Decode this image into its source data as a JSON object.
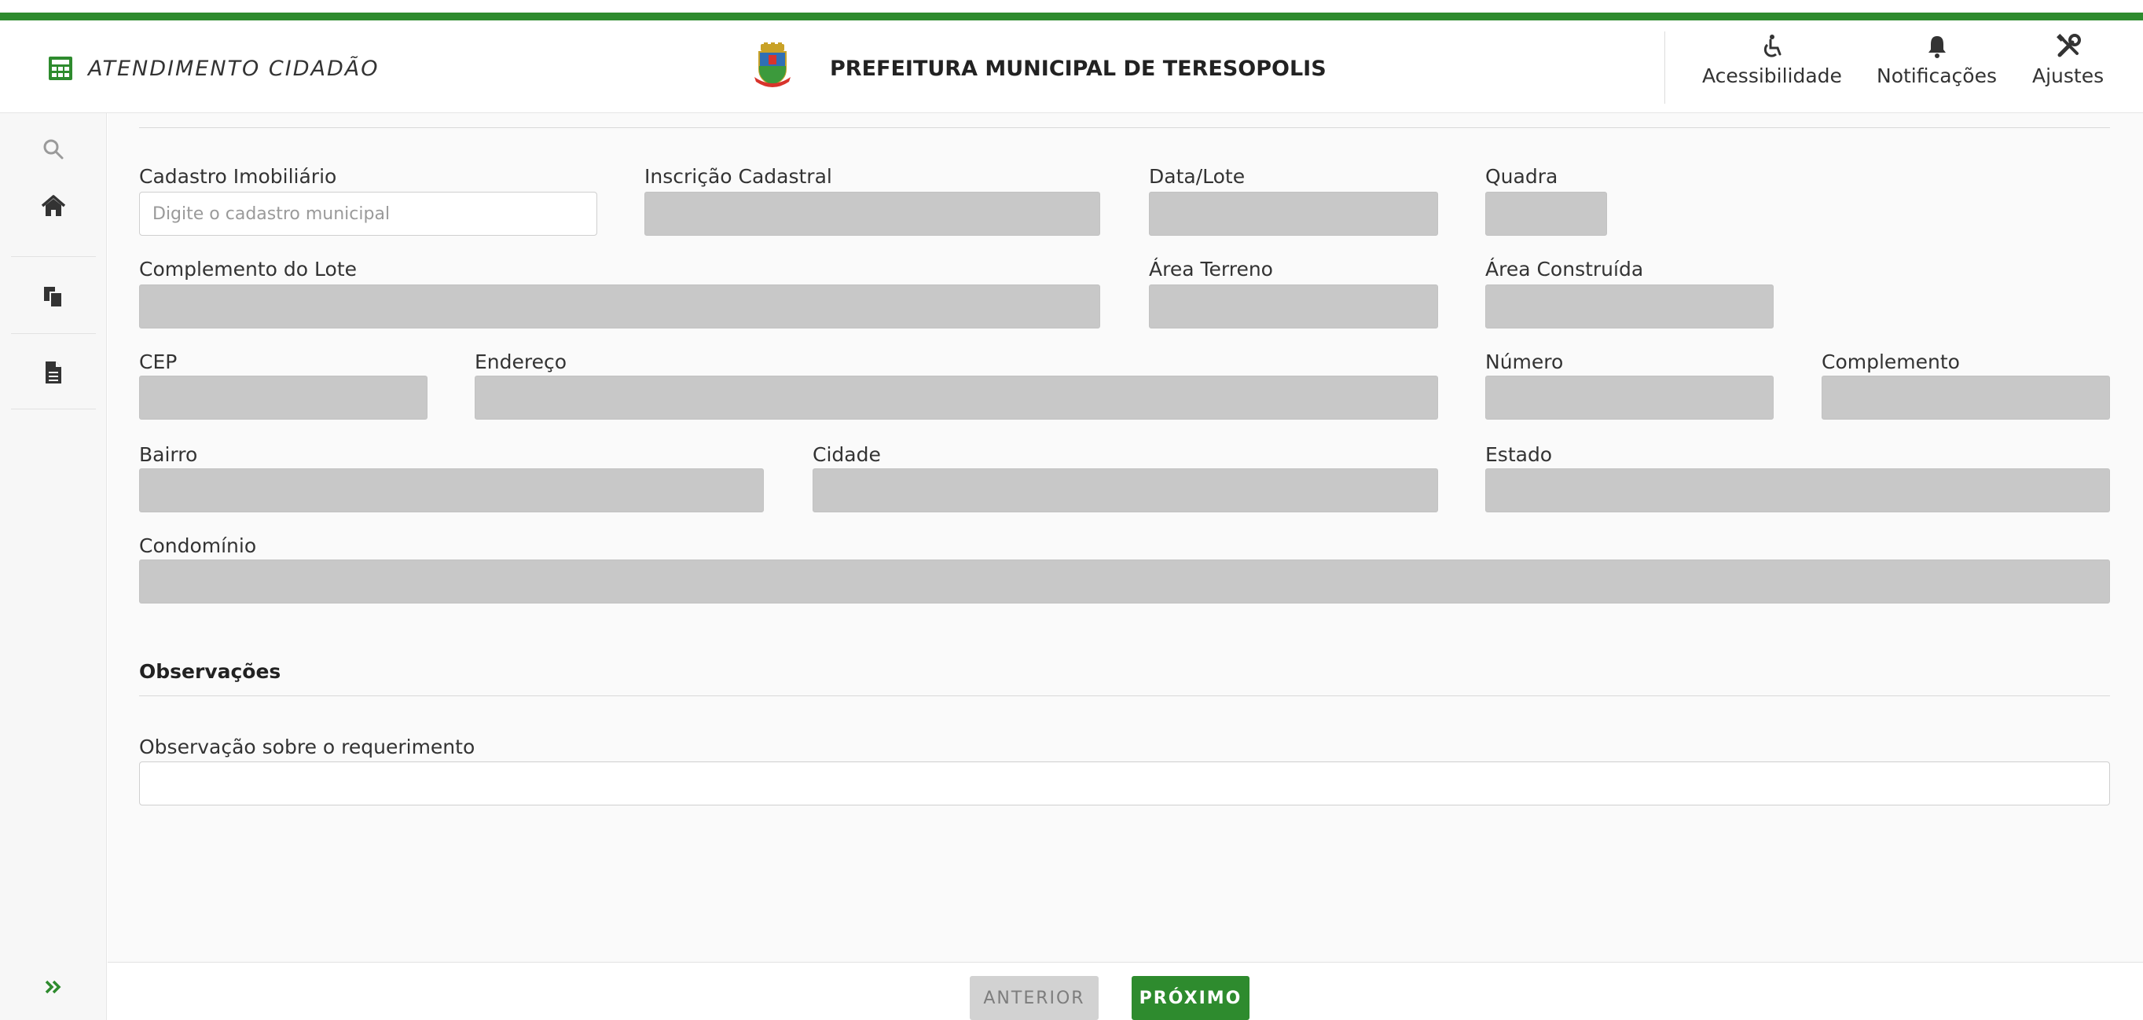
{
  "header": {
    "app_title": "ATENDIMENTO CIDADÃO",
    "municipality": "PREFEITURA MUNICIPAL DE TERESOPOLIS",
    "actions": [
      {
        "label": "Acessibilidade",
        "icon": "wheelchair-icon"
      },
      {
        "label": "Notificações",
        "icon": "bell-icon"
      },
      {
        "label": "Ajustes",
        "icon": "tools-icon"
      }
    ]
  },
  "sidebar": {
    "items": [
      {
        "icon": "search-icon"
      },
      {
        "icon": "home-icon"
      },
      {
        "icon": "copy-icon"
      },
      {
        "icon": "document-icon"
      }
    ],
    "expand_icon": "double-chevron-right-icon"
  },
  "form": {
    "cadastro_label": "Cadastro Imobiliário",
    "cadastro_placeholder": "Digite o cadastro municipal",
    "inscricao_label": "Inscrição Cadastral",
    "data_lote_label": "Data/Lote",
    "quadra_label": "Quadra",
    "complemento_lote_label": "Complemento do Lote",
    "area_terreno_label": "Área Terreno",
    "area_construida_label": "Área Construída",
    "cep_label": "CEP",
    "endereco_label": "Endereço",
    "numero_label": "Número",
    "complemento_label": "Complemento",
    "bairro_label": "Bairro",
    "cidade_label": "Cidade",
    "estado_label": "Estado",
    "condominio_label": "Condomínio"
  },
  "observacoes": {
    "title": "Observações",
    "field_label": "Observação sobre o requerimento"
  },
  "footer": {
    "prev_label": "ANTERIOR",
    "next_label": "PRÓXIMO"
  },
  "colors": {
    "brand_green": "#2e8b2e",
    "disabled_field": "#c8c8c8"
  }
}
